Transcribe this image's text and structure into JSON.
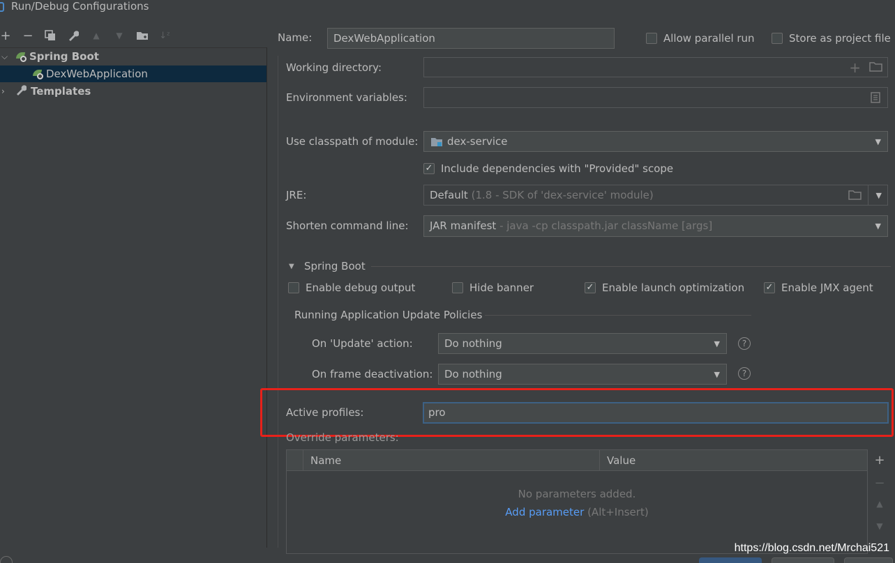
{
  "window": {
    "title": "Run/Debug Configurations"
  },
  "toolbar": {
    "add": "+",
    "remove": "−",
    "copy": "⧉",
    "edit": "🔧",
    "up": "▲",
    "down": "▼",
    "folder": "📁",
    "sort": "↓²"
  },
  "tree": {
    "group": "Spring Boot",
    "item": "DexWebApplication",
    "templates": "Templates"
  },
  "form": {
    "name_label": "Name:",
    "name_value": "DexWebApplication",
    "allow_parallel": "Allow parallel run",
    "store_as_project": "Store as project file",
    "working_dir_label": "Working directory:",
    "env_vars_label": "Environment variables:",
    "classpath_label": "Use classpath of module:",
    "classpath_value": "dex-service",
    "include_deps": "Include dependencies with \"Provided\" scope",
    "jre_label": "JRE:",
    "jre_value": "Default",
    "jre_hint": "(1.8 - SDK of 'dex-service' module)",
    "shorten_label": "Shorten command line:",
    "shorten_value": "JAR manifest",
    "shorten_hint": "- java -cp classpath.jar className [args]"
  },
  "spring_boot": {
    "section": "Spring Boot",
    "enable_debug": "Enable debug output",
    "hide_banner": "Hide banner",
    "enable_launch": "Enable launch optimization",
    "enable_jmx": "Enable JMX agent",
    "policies_title": "Running Application Update Policies",
    "on_update_label": "On 'Update' action:",
    "on_update_value": "Do nothing",
    "on_frame_label": "On frame deactivation:",
    "on_frame_value": "Do nothing",
    "active_profiles_label": "Active profiles:",
    "active_profiles_value": "pro",
    "override_label": "Override parameters:"
  },
  "params_table": {
    "col_name": "Name",
    "col_value": "Value",
    "empty": "No parameters added.",
    "add_link": "Add parameter",
    "add_shortcut": "(Alt+Insert)"
  },
  "watermark": "https://blog.csdn.net/Mrchai521",
  "colors": {
    "accent": "#589df6",
    "selection": "#0d293e",
    "highlight": "#e8211a"
  }
}
